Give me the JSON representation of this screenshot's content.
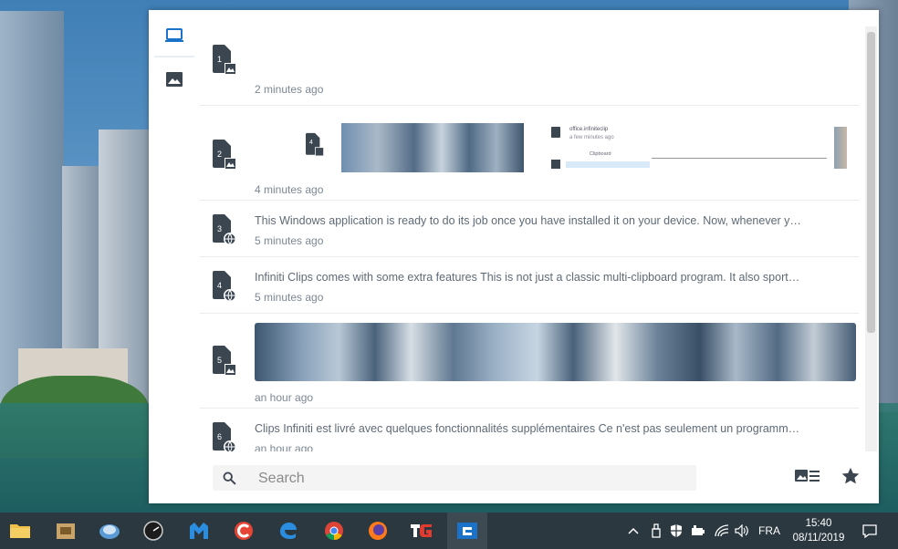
{
  "window": {
    "items": [
      {
        "num": "1",
        "kind": "image",
        "time": "2 minutes ago",
        "text": ""
      },
      {
        "num": "2",
        "kind": "image",
        "time": "4 minutes ago",
        "text": ""
      },
      {
        "num": "3",
        "kind": "web",
        "time": "5 minutes ago",
        "text": "This Windows application is ready to do its job once you have installed it on your device. Now, whenever you copy a..."
      },
      {
        "num": "4",
        "kind": "web",
        "time": "5 minutes ago",
        "text": "Infiniti Clips comes with some extra features  This is not just a classic multi-clipboard program. It also sports some ..."
      },
      {
        "num": "5",
        "kind": "image",
        "time": "an hour ago",
        "text": ""
      },
      {
        "num": "6",
        "kind": "web",
        "time": "an hour ago",
        "text": "Clips Infiniti est livré avec quelques fonctionnalités supplémentaires  Ce n'est pas seulement un programme multi-..."
      }
    ],
    "nested_preview": {
      "num": "4",
      "line1": "office.infiniteclip",
      "line2": "a few minutes ago",
      "line3": "Clipboard"
    },
    "search": {
      "placeholder": "Search"
    }
  },
  "taskbar": {
    "language": "FRA",
    "time": "15:40",
    "date": "08/11/2019"
  },
  "colors": {
    "accent": "#1a73c8",
    "icon": "#3b4651",
    "taskbar": "#2b3840"
  }
}
